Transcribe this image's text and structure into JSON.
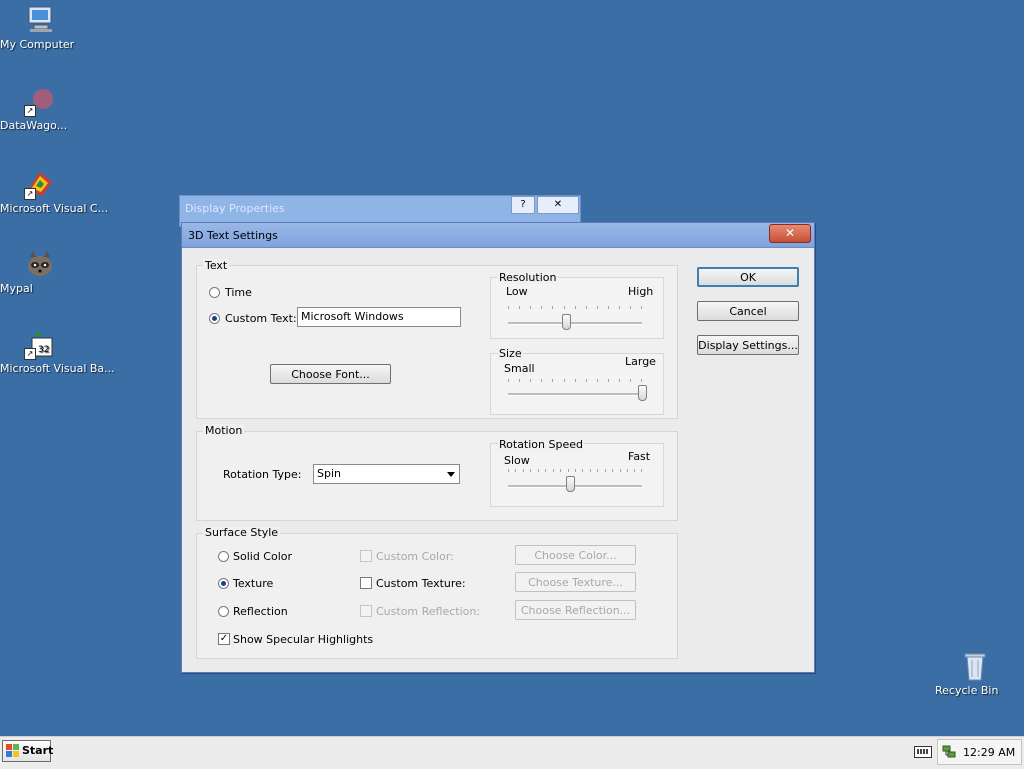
{
  "desktop": {
    "icons": [
      {
        "label": "My Computer"
      },
      {
        "label": "DataWago..."
      },
      {
        "label": "Microsoft Visual C..."
      },
      {
        "label": "Mypal"
      },
      {
        "label": "Microsoft Visual Ba..."
      },
      {
        "label": "Recycle Bin"
      }
    ]
  },
  "background_dialog": {
    "title": "Display Properties",
    "help": "?",
    "close": "✕"
  },
  "dialog": {
    "title": "3D Text Settings",
    "close": "✕",
    "text_group": {
      "title": "Text",
      "time_label": "Time",
      "custom_text_label": "Custom Text:",
      "custom_text_value": "Microsoft Windows",
      "choose_font": "Choose Font...",
      "selected": "custom_text"
    },
    "resolution": {
      "title": "Resolution",
      "low": "Low",
      "high": "High",
      "value": 0.44
    },
    "size": {
      "title": "Size",
      "small": "Small",
      "large": "Large",
      "value": 1.0
    },
    "motion_group": {
      "title": "Motion",
      "rotation_type_label": "Rotation Type:",
      "rotation_type_value": "Spin"
    },
    "rotation_speed": {
      "title": "Rotation Speed",
      "slow": "Slow",
      "fast": "Fast",
      "value": 0.47
    },
    "surface_group": {
      "title": "Surface Style",
      "solid_color": "Solid Color",
      "texture": "Texture",
      "reflection": "Reflection",
      "custom_color": "Custom Color:",
      "custom_texture": "Custom Texture:",
      "custom_reflection": "Custom Reflection:",
      "choose_color": "Choose Color...",
      "choose_texture": "Choose Texture...",
      "choose_reflection": "Choose Reflection...",
      "specular": "Show Specular Highlights",
      "specular_checked": true,
      "selected": "texture"
    },
    "buttons": {
      "ok": "OK",
      "cancel": "Cancel",
      "display_settings": "Display Settings..."
    }
  },
  "taskbar": {
    "start": "Start",
    "clock": "12:29 AM"
  },
  "colors": {
    "desktop": "#3a6ea5",
    "dialog_bg": "#ebebeb",
    "title_bar": "#7ea3dd",
    "close_button": "#c64f34"
  }
}
